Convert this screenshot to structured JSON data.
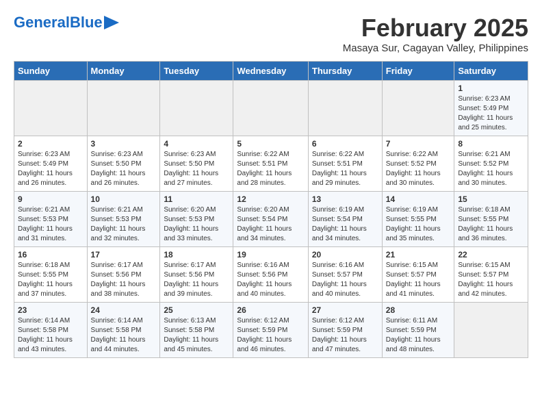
{
  "logo": {
    "text_general": "General",
    "text_blue": "Blue"
  },
  "title": {
    "month_year": "February 2025",
    "location": "Masaya Sur, Cagayan Valley, Philippines"
  },
  "weekdays": [
    "Sunday",
    "Monday",
    "Tuesday",
    "Wednesday",
    "Thursday",
    "Friday",
    "Saturday"
  ],
  "weeks": [
    [
      {
        "day": "",
        "info": ""
      },
      {
        "day": "",
        "info": ""
      },
      {
        "day": "",
        "info": ""
      },
      {
        "day": "",
        "info": ""
      },
      {
        "day": "",
        "info": ""
      },
      {
        "day": "",
        "info": ""
      },
      {
        "day": "1",
        "info": "Sunrise: 6:23 AM\nSunset: 5:49 PM\nDaylight: 11 hours and 25 minutes."
      }
    ],
    [
      {
        "day": "2",
        "info": "Sunrise: 6:23 AM\nSunset: 5:49 PM\nDaylight: 11 hours and 26 minutes."
      },
      {
        "day": "3",
        "info": "Sunrise: 6:23 AM\nSunset: 5:50 PM\nDaylight: 11 hours and 26 minutes."
      },
      {
        "day": "4",
        "info": "Sunrise: 6:23 AM\nSunset: 5:50 PM\nDaylight: 11 hours and 27 minutes."
      },
      {
        "day": "5",
        "info": "Sunrise: 6:22 AM\nSunset: 5:51 PM\nDaylight: 11 hours and 28 minutes."
      },
      {
        "day": "6",
        "info": "Sunrise: 6:22 AM\nSunset: 5:51 PM\nDaylight: 11 hours and 29 minutes."
      },
      {
        "day": "7",
        "info": "Sunrise: 6:22 AM\nSunset: 5:52 PM\nDaylight: 11 hours and 30 minutes."
      },
      {
        "day": "8",
        "info": "Sunrise: 6:21 AM\nSunset: 5:52 PM\nDaylight: 11 hours and 30 minutes."
      }
    ],
    [
      {
        "day": "9",
        "info": "Sunrise: 6:21 AM\nSunset: 5:53 PM\nDaylight: 11 hours and 31 minutes."
      },
      {
        "day": "10",
        "info": "Sunrise: 6:21 AM\nSunset: 5:53 PM\nDaylight: 11 hours and 32 minutes."
      },
      {
        "day": "11",
        "info": "Sunrise: 6:20 AM\nSunset: 5:53 PM\nDaylight: 11 hours and 33 minutes."
      },
      {
        "day": "12",
        "info": "Sunrise: 6:20 AM\nSunset: 5:54 PM\nDaylight: 11 hours and 34 minutes."
      },
      {
        "day": "13",
        "info": "Sunrise: 6:19 AM\nSunset: 5:54 PM\nDaylight: 11 hours and 34 minutes."
      },
      {
        "day": "14",
        "info": "Sunrise: 6:19 AM\nSunset: 5:55 PM\nDaylight: 11 hours and 35 minutes."
      },
      {
        "day": "15",
        "info": "Sunrise: 6:18 AM\nSunset: 5:55 PM\nDaylight: 11 hours and 36 minutes."
      }
    ],
    [
      {
        "day": "16",
        "info": "Sunrise: 6:18 AM\nSunset: 5:55 PM\nDaylight: 11 hours and 37 minutes."
      },
      {
        "day": "17",
        "info": "Sunrise: 6:17 AM\nSunset: 5:56 PM\nDaylight: 11 hours and 38 minutes."
      },
      {
        "day": "18",
        "info": "Sunrise: 6:17 AM\nSunset: 5:56 PM\nDaylight: 11 hours and 39 minutes."
      },
      {
        "day": "19",
        "info": "Sunrise: 6:16 AM\nSunset: 5:56 PM\nDaylight: 11 hours and 40 minutes."
      },
      {
        "day": "20",
        "info": "Sunrise: 6:16 AM\nSunset: 5:57 PM\nDaylight: 11 hours and 40 minutes."
      },
      {
        "day": "21",
        "info": "Sunrise: 6:15 AM\nSunset: 5:57 PM\nDaylight: 11 hours and 41 minutes."
      },
      {
        "day": "22",
        "info": "Sunrise: 6:15 AM\nSunset: 5:57 PM\nDaylight: 11 hours and 42 minutes."
      }
    ],
    [
      {
        "day": "23",
        "info": "Sunrise: 6:14 AM\nSunset: 5:58 PM\nDaylight: 11 hours and 43 minutes."
      },
      {
        "day": "24",
        "info": "Sunrise: 6:14 AM\nSunset: 5:58 PM\nDaylight: 11 hours and 44 minutes."
      },
      {
        "day": "25",
        "info": "Sunrise: 6:13 AM\nSunset: 5:58 PM\nDaylight: 11 hours and 45 minutes."
      },
      {
        "day": "26",
        "info": "Sunrise: 6:12 AM\nSunset: 5:59 PM\nDaylight: 11 hours and 46 minutes."
      },
      {
        "day": "27",
        "info": "Sunrise: 6:12 AM\nSunset: 5:59 PM\nDaylight: 11 hours and 47 minutes."
      },
      {
        "day": "28",
        "info": "Sunrise: 6:11 AM\nSunset: 5:59 PM\nDaylight: 11 hours and 48 minutes."
      },
      {
        "day": "",
        "info": ""
      }
    ]
  ]
}
